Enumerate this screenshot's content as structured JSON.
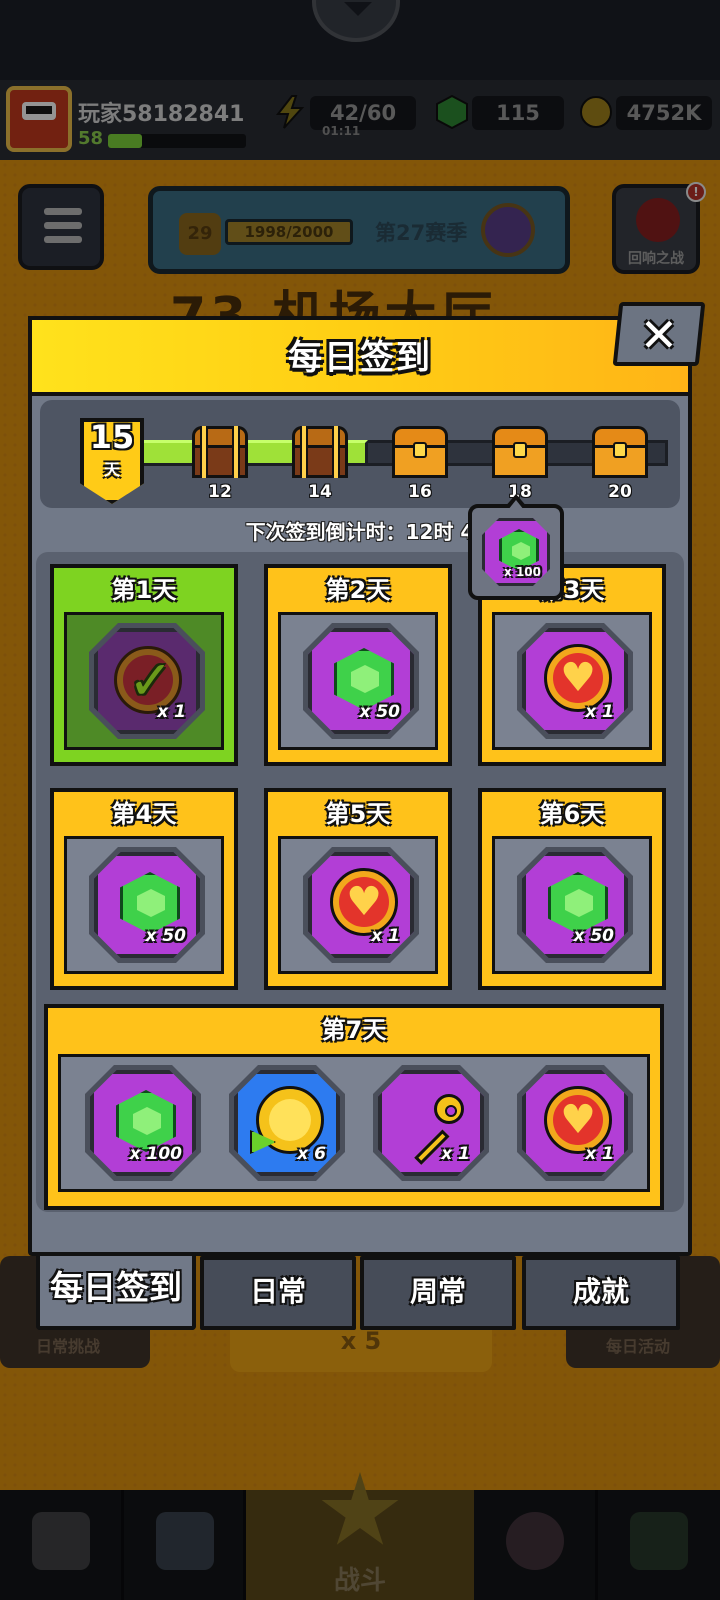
{
  "player": {
    "name": "玩家58182841",
    "level": "58"
  },
  "resources": {
    "energy": "42/60",
    "energy_timer": "01:11",
    "gems": "115",
    "coins": "4752K"
  },
  "season": {
    "level": "29",
    "progress": "1998/2000",
    "name": "第27赛季"
  },
  "echo_battle": {
    "label": "回响之战",
    "badge": "!"
  },
  "bg_title": "73 机场大厅",
  "bg_bottom": {
    "daily_challenge": "日常挑战",
    "energy_cost": "x 5",
    "daily_event": "每日活动",
    "battle": "战斗"
  },
  "dialog": {
    "title": "每日签到",
    "close": "✕",
    "current_day": "15",
    "day_unit": "天",
    "milestones": [
      "12",
      "14",
      "16",
      "18",
      "20"
    ],
    "countdown": "下次签到倒计时：12时 4",
    "tooltip_qty": "x 100"
  },
  "days": [
    {
      "title": "第1天",
      "qty": "x 1",
      "reward": "check-coin",
      "claimed": true
    },
    {
      "title": "第2天",
      "qty": "x 50",
      "reward": "gem"
    },
    {
      "title": "第3天",
      "qty": "x 1",
      "reward": "heart-coin"
    },
    {
      "title": "第4天",
      "qty": "x 50",
      "reward": "gem"
    },
    {
      "title": "第5天",
      "qty": "x 1",
      "reward": "heart-coin"
    },
    {
      "title": "第6天",
      "qty": "x 50",
      "reward": "gem"
    }
  ],
  "day7": {
    "title": "第7天",
    "rewards": [
      {
        "qty": "x 100",
        "reward": "gem"
      },
      {
        "qty": "x 6",
        "reward": "gold-coin-fast-forward"
      },
      {
        "qty": "x 1",
        "reward": "key"
      },
      {
        "qty": "x 1",
        "reward": "heart-coin"
      }
    ]
  },
  "tabs": [
    "每日签到",
    "日常",
    "周常",
    "成就"
  ],
  "colors": {
    "accent_yellow": "#ffc21a",
    "claimed_green": "#7ed321",
    "item_purple": "#b23ed6",
    "panel_gray": "#717988"
  }
}
